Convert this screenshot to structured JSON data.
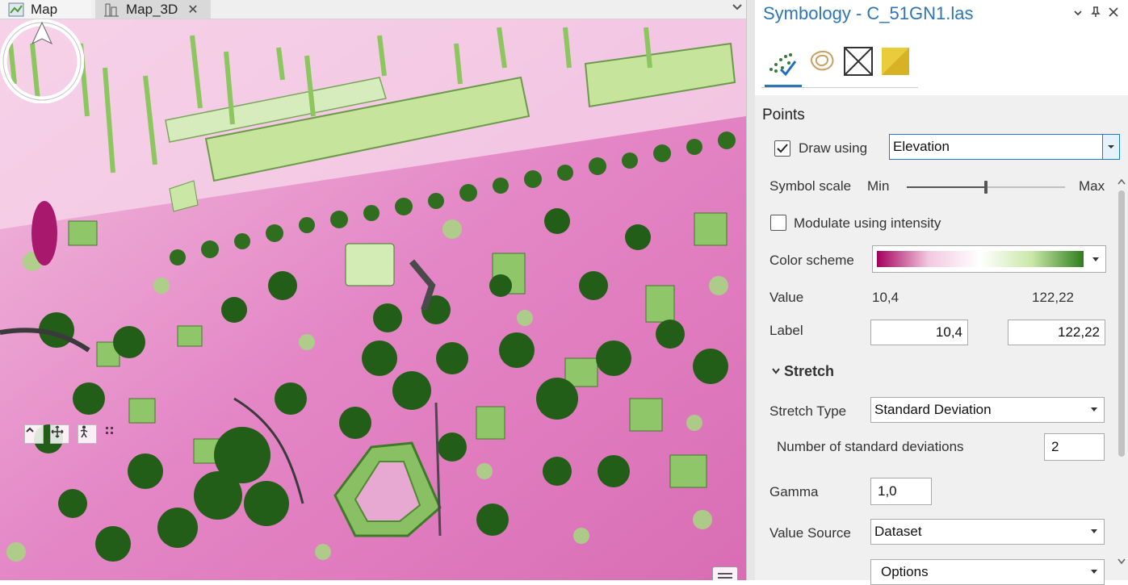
{
  "tabs": [
    {
      "label": "Map",
      "icon": "map-icon"
    },
    {
      "label": "Map_3D",
      "icon": "scene-icon",
      "close": "✕"
    }
  ],
  "panel": {
    "title": "Symbology - C_51GN1.las",
    "tab_icons": [
      "points-symbology-icon",
      "contour-icon",
      "triangles-icon",
      "edges-icon"
    ],
    "points_header": "Points",
    "draw_using_label": "Draw using",
    "draw_using_value": "Elevation",
    "draw_using_checked": true,
    "symbol_scale_label": "Symbol scale",
    "symbol_scale_min": "Min",
    "symbol_scale_max": "Max",
    "symbol_scale_level": 0.5,
    "modulate_label": "Modulate using intensity",
    "modulate_checked": false,
    "color_scheme_label": "Color scheme",
    "color_scheme_colors": [
      "#a4005e",
      "#f3c9e0",
      "#ffffff",
      "#c9e8a8",
      "#2f7e1c"
    ],
    "value_label": "Value",
    "value_min": "10,4",
    "value_max": "122,22",
    "label_label": "Label",
    "label_min": "10,4",
    "label_max": "122,22",
    "stretch_header": "Stretch",
    "stretch_type_label": "Stretch Type",
    "stretch_type_value": "Standard Deviation",
    "num_std_label": "Number of standard deviations",
    "num_std_value": "2",
    "gamma_label": "Gamma",
    "gamma_value": "1,0",
    "value_source_label": "Value Source",
    "value_source_value": "Dataset",
    "options_label": "Options"
  },
  "colors": {
    "accent": "#2e75b6",
    "map_pink": "#e77fc2",
    "map_green": "#3f8f2a",
    "map_dark_green": "#1f5e17",
    "map_light_green": "#b7dd8f"
  }
}
